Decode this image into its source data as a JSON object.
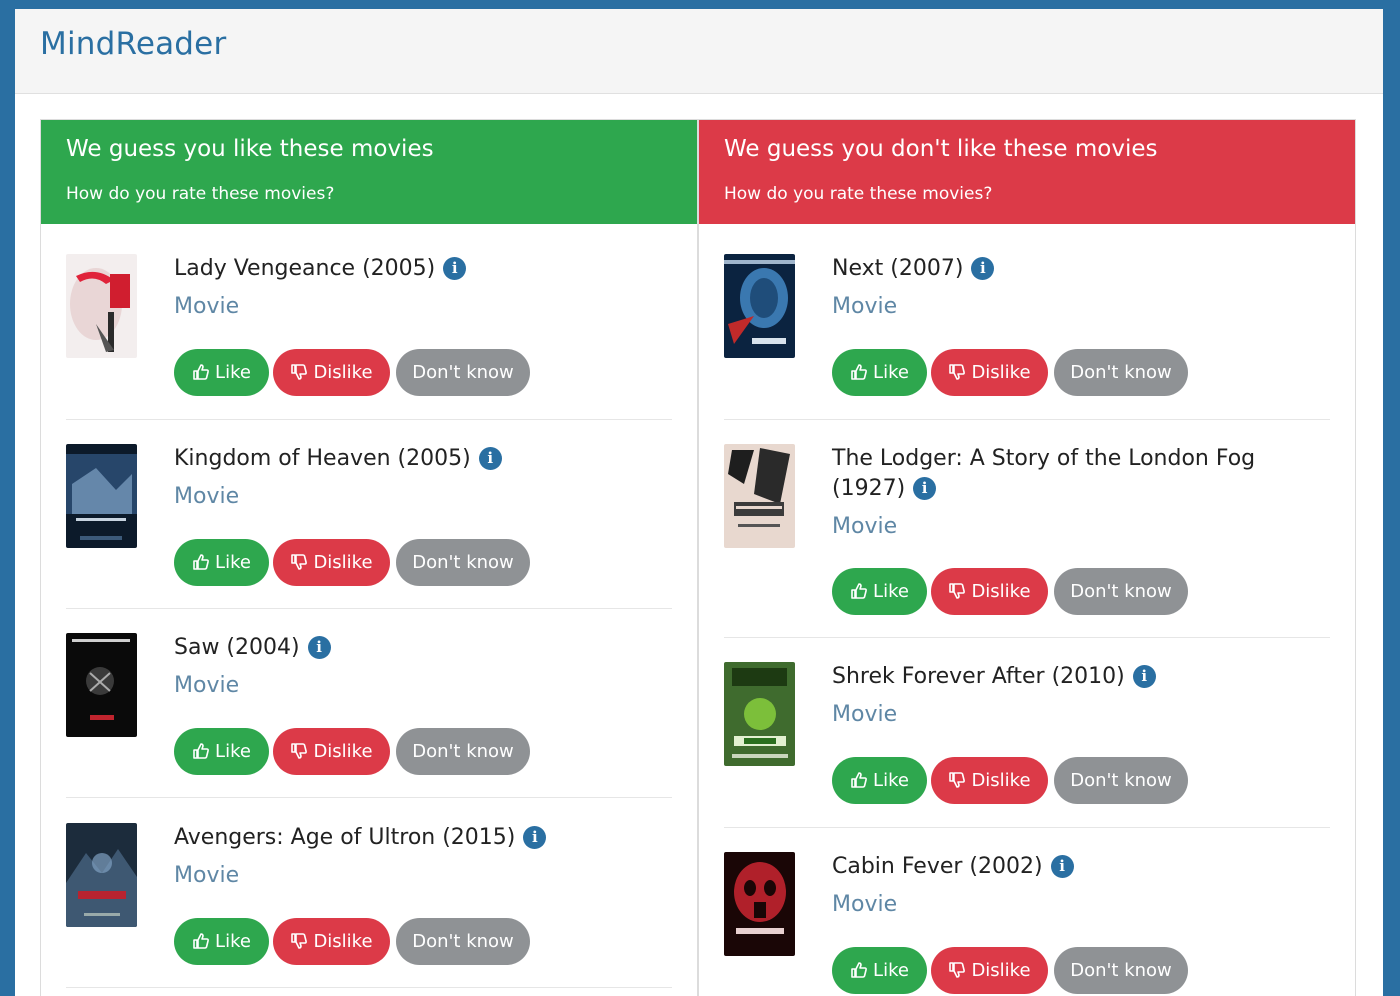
{
  "app": {
    "title": "MindReader"
  },
  "panels": {
    "like": {
      "title": "We guess you like these movies",
      "subtitle": "How do you rate these movies?",
      "items": [
        {
          "title": "Lady Vengeance (2005)",
          "type": "Movie"
        },
        {
          "title": "Kingdom of Heaven (2005)",
          "type": "Movie"
        },
        {
          "title": "Saw (2004)",
          "type": "Movie"
        },
        {
          "title": "Avengers: Age of Ultron (2015)",
          "type": "Movie"
        }
      ]
    },
    "dislike": {
      "title": "We guess you don't like these movies",
      "subtitle": "How do you rate these movies?",
      "items": [
        {
          "title": "Next (2007)",
          "type": "Movie"
        },
        {
          "title": "The Lodger: A Story of the London Fog (1927)",
          "type": "Movie"
        },
        {
          "title": "Shrek Forever After (2010)",
          "type": "Movie"
        },
        {
          "title": "Cabin Fever (2002)",
          "type": "Movie"
        }
      ]
    }
  },
  "buttons": {
    "like": "Like",
    "dislike": "Dislike",
    "dont_know": "Don't know"
  },
  "icons": {
    "info": "info-icon",
    "like": "thumbs-up-icon",
    "dislike": "thumbs-down-icon"
  },
  "colors": {
    "brand": "#2a6fa2",
    "like": "#2ea74e",
    "dislike": "#dc3a48",
    "neutral": "#8f9295",
    "type_text": "#5f87a5"
  }
}
